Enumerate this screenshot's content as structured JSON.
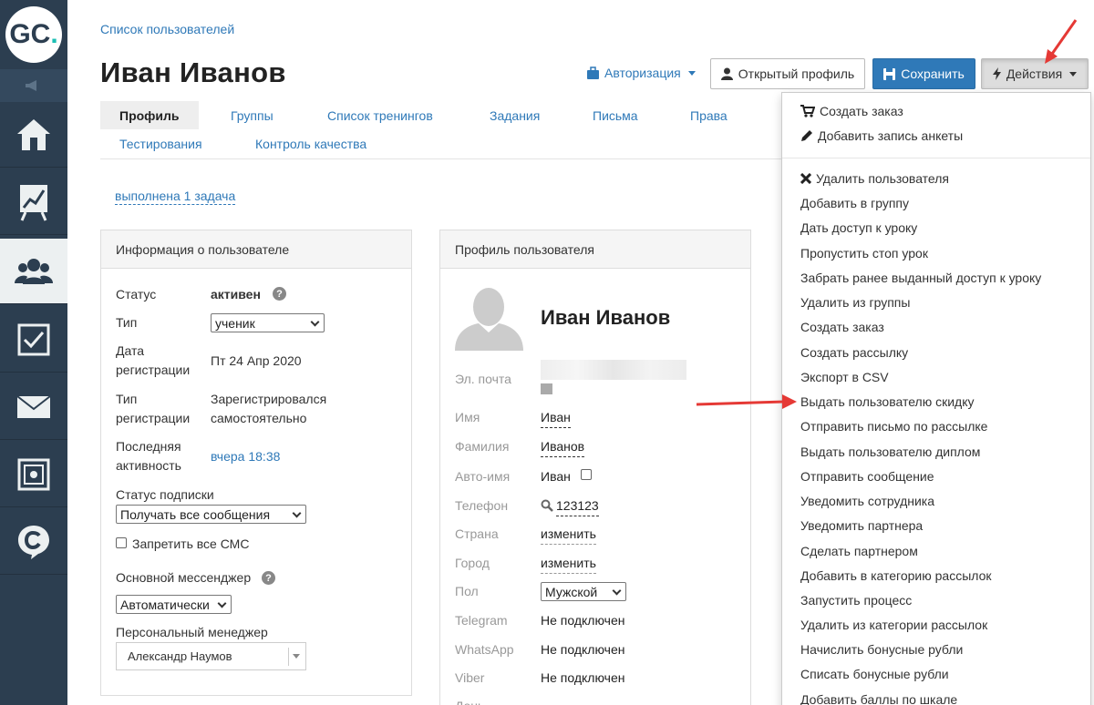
{
  "app": {
    "logo_text": "GC",
    "logo_dot": "."
  },
  "sidebar": {
    "items": [
      {
        "name": "home",
        "icon": "home-icon"
      },
      {
        "name": "analytics",
        "icon": "chart-board-icon"
      },
      {
        "name": "users",
        "icon": "users-icon",
        "active": true
      },
      {
        "name": "tasks",
        "icon": "checkbox-icon"
      },
      {
        "name": "mail",
        "icon": "envelope-icon"
      },
      {
        "name": "sales",
        "icon": "safe-icon"
      },
      {
        "name": "chat",
        "icon": "chat-c-icon"
      }
    ]
  },
  "header": {
    "breadcrumb": "Список пользователей",
    "title": "Иван Иванов",
    "auth_label": "Авторизация",
    "open_profile_label": "Открытый профиль",
    "save_label": "Сохранить",
    "actions_label": "Действия"
  },
  "tabs": [
    "Профиль",
    "Группы",
    "Список тренингов",
    "Задания",
    "Письма",
    "Права",
    "Тестирования",
    "Контроль качества"
  ],
  "task_link": "выполнена 1 задача",
  "user_info": {
    "heading": "Информация о пользователе",
    "status_label": "Статус",
    "status_value": "активен",
    "type_label": "Тип",
    "type_value": "ученик",
    "reg_date_label_1": "Дата",
    "reg_date_label_2": "регистрации",
    "reg_date_value": "Пт 24 Апр 2020",
    "reg_type_label_1": "Тип",
    "reg_type_label_2": "регистрации",
    "reg_type_value_1": "Зарегистрировался",
    "reg_type_value_2": "самостоятельно",
    "last_active_label_1": "Последняя",
    "last_active_label_2": "активность",
    "last_active_value": "вчера 18:38",
    "subscription_label": "Статус подписки",
    "subscription_value": "Получать все сообщения",
    "ban_sms_label": "Запретить все СМС",
    "messenger_label": "Основной мессенджер",
    "messenger_value": "Автоматически",
    "manager_label": "Персональный менеджер",
    "manager_value": "Александр Наумов"
  },
  "profile": {
    "heading": "Профиль пользователя",
    "name": "Иван Иванов",
    "email_label": "Эл. почта",
    "first_name_label": "Имя",
    "first_name_value": "Иван",
    "last_name_label": "Фамилия",
    "last_name_value": "Иванов",
    "auto_name_label": "Авто-имя",
    "auto_name_value": "Иван",
    "phone_label": "Телефон",
    "phone_value": "123123",
    "country_label": "Страна",
    "country_value": "изменить",
    "city_label": "Город",
    "city_value": "изменить",
    "gender_label": "Пол",
    "gender_value": "Мужской",
    "telegram_label": "Telegram",
    "telegram_value": "Не подключен",
    "whatsapp_label": "WhatsApp",
    "whatsapp_value": "Не подключен",
    "viber_label": "Viber",
    "viber_value": "Не подключен",
    "cut_label": "День"
  },
  "actions_menu": {
    "top": [
      {
        "label": "Создать заказ",
        "icon": "cart-icon"
      },
      {
        "label": "Добавить запись анкеты",
        "icon": "pencil-icon"
      }
    ],
    "items": [
      {
        "label": "Удалить пользователя",
        "icon": "close-icon"
      },
      {
        "label": "Добавить в группу"
      },
      {
        "label": "Дать доступ к уроку"
      },
      {
        "label": "Пропустить стоп урок"
      },
      {
        "label": "Забрать ранее выданный доступ к уроку"
      },
      {
        "label": "Удалить из группы"
      },
      {
        "label": "Создать заказ"
      },
      {
        "label": "Создать рассылку"
      },
      {
        "label": "Экспорт в CSV"
      },
      {
        "label": "Выдать пользователю скидку"
      },
      {
        "label": "Отправить письмо по рассылке"
      },
      {
        "label": "Выдать пользователю диплом"
      },
      {
        "label": "Отправить сообщение"
      },
      {
        "label": "Уведомить сотрудника"
      },
      {
        "label": "Уведомить партнера"
      },
      {
        "label": "Сделать партнером"
      },
      {
        "label": "Добавить в категорию рассылок"
      },
      {
        "label": "Запустить процесс"
      },
      {
        "label": "Удалить из категории рассылок"
      },
      {
        "label": "Начислить бонусные рубли"
      },
      {
        "label": "Списать бонусные рубли"
      },
      {
        "label": "Добавить баллы по шкале"
      }
    ]
  },
  "colors": {
    "sidebar": "#2c3e50",
    "link": "#2f79b8",
    "save_button": "#2f79b8",
    "annotation_arrow": "#e53935"
  }
}
